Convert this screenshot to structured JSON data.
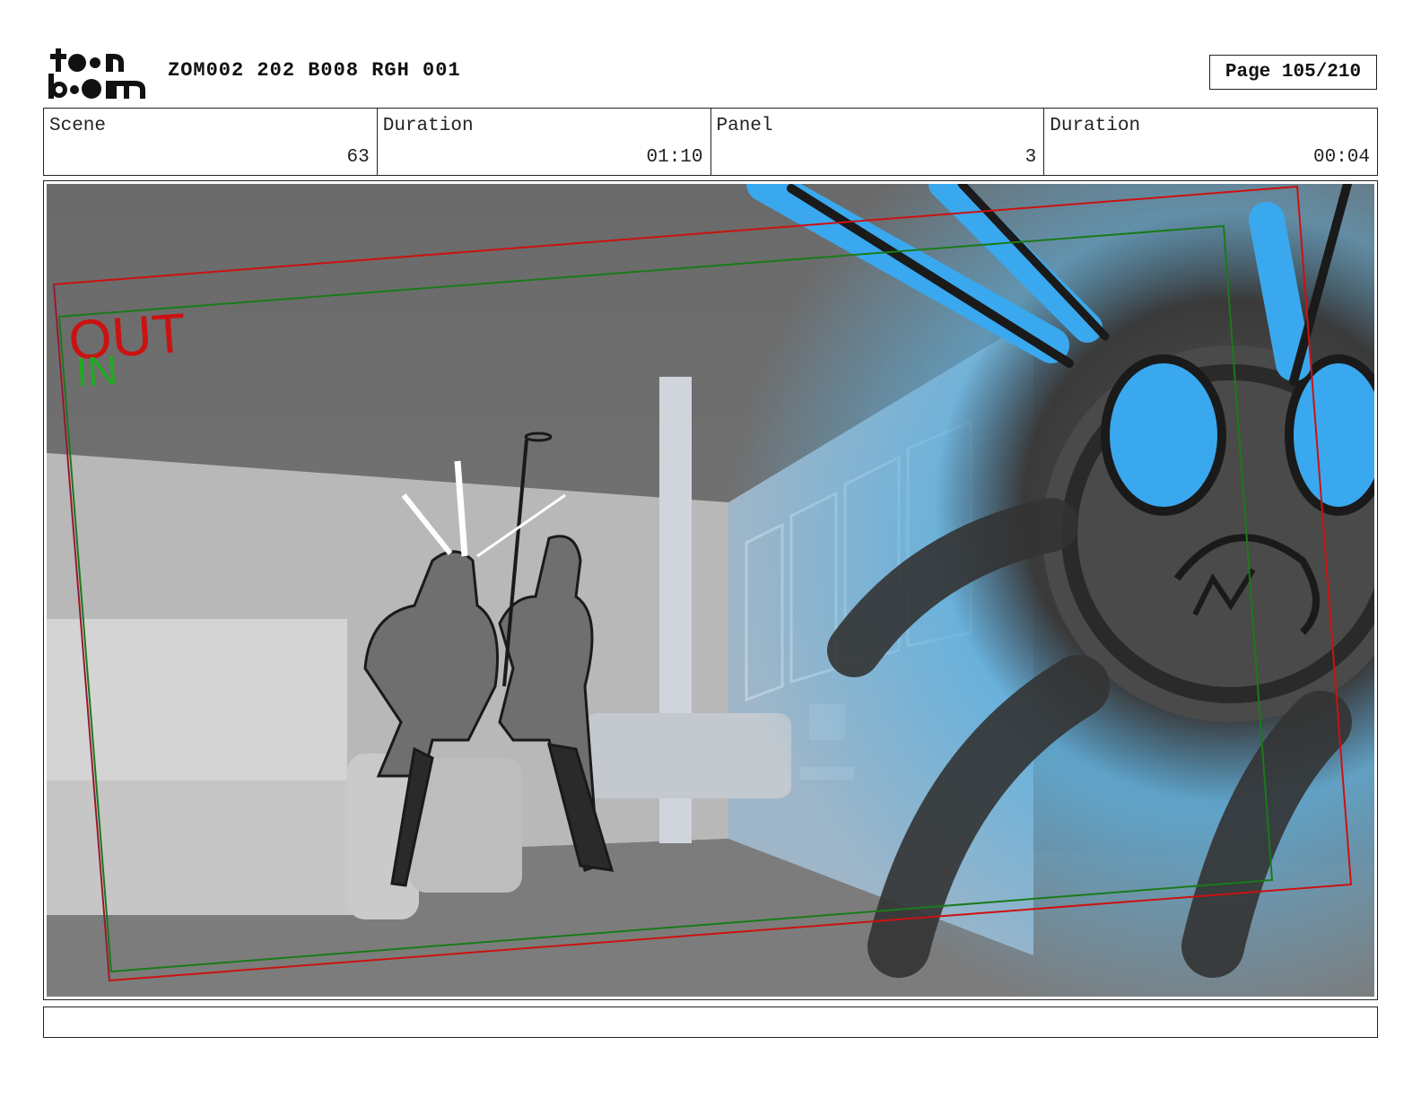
{
  "header": {
    "logo_line1": "toon",
    "logo_line2": "boom",
    "doc_title": "ZOM002 202 B008 RGH 001",
    "page_label": "Page 105/210"
  },
  "info": {
    "scene_label": "Scene",
    "scene_value": "63",
    "scene_duration_label": "Duration",
    "scene_duration_value": "01:10",
    "panel_label": "Panel",
    "panel_value": "3",
    "panel_duration_label": "Duration",
    "panel_duration_value": "00:04"
  },
  "panel": {
    "out_label": "OUT",
    "in_label": "IN",
    "out_color": "#cc1111",
    "in_color": "#22aa22",
    "creature_color": "#3aa8ee"
  },
  "notes": {
    "text": ""
  }
}
